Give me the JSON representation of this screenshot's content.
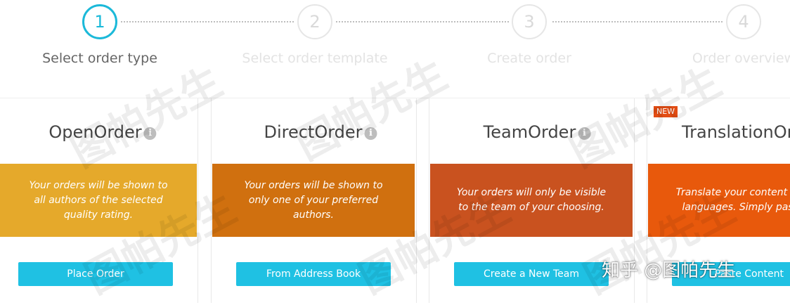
{
  "stepper": {
    "steps": [
      {
        "number": "1",
        "label": "Select order type",
        "active": true
      },
      {
        "number": "2",
        "label": "Select order template",
        "active": false
      },
      {
        "number": "3",
        "label": "Create order",
        "active": false
      },
      {
        "number": "4",
        "label": "Order overview",
        "active": false
      }
    ]
  },
  "cards": [
    {
      "title": "OpenOrder",
      "info_icon": "info-icon",
      "description": "Your orders will be shown to all authors of the selected quality rating.",
      "band_color": "#E5A92B",
      "button_label": "Place Order"
    },
    {
      "title": "DirectOrder",
      "info_icon": "info-icon",
      "description": "Your orders will be shown to only one of your preferred authors.",
      "band_color": "#D0700F",
      "button_label": "From Address Book"
    },
    {
      "title": "TeamOrder",
      "info_icon": "info-icon",
      "description": "Your orders will only be visible to the team of your choosing.",
      "band_color": "#C9521F",
      "button_label": "Create a New Team"
    },
    {
      "badge": "NEW",
      "title": "TranslationOrder",
      "description": "Translate your content to many languages. Simply paste and",
      "band_color": "#E8590C",
      "button_label": "Paste Content"
    }
  ],
  "colors": {
    "accent": "#1BB9D9",
    "button": "#1FC1E3",
    "badge": "#E24C13"
  },
  "watermark": {
    "text": "图帕先生",
    "credit": "知乎 @图帕先生"
  }
}
